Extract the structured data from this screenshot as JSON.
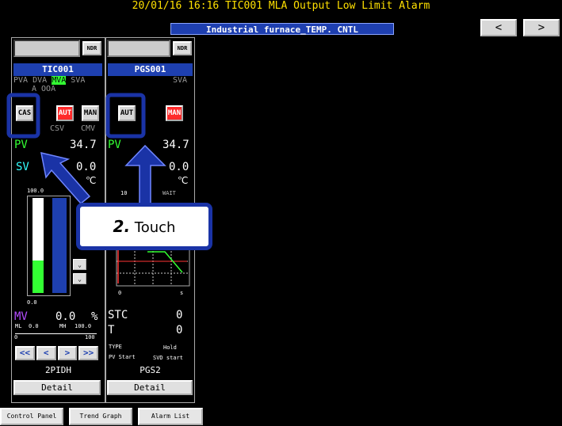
{
  "alarm_message": "20/01/16 16:16 TIC001 MLA Output Low Limit Alarm",
  "window_title": "Industrial furnace_TEMP. CNTL",
  "nav": {
    "prev": "<",
    "next": ">"
  },
  "faceplate1": {
    "ndr": "NDR",
    "tag": "TIC001",
    "modes_row1": [
      "PVA",
      "DVA",
      "MVA",
      "SVA"
    ],
    "modes_row2": "A OOA",
    "cas": "CAS",
    "aut": "AUT",
    "man": "MAN",
    "csv_label": "CSV",
    "cmv_label": "CMV",
    "pv_label": "PV",
    "pv_value": "34.7",
    "sv_label": "SV",
    "sv_value": "0.0",
    "unit": "℃",
    "scale_top": "100.0",
    "scale_bottom": "0.0",
    "mv_label": "MV",
    "mv_value": "0.0",
    "mv_unit": "%",
    "ml_label": "ML",
    "ml_value": "0.0",
    "mh_label": "MH",
    "mh_value": "100.0",
    "axis_min": "0",
    "axis_max": "100",
    "btns": [
      "<<",
      "<",
      ">",
      ">>"
    ],
    "control_type": "2PIDH",
    "detail": "Detail"
  },
  "faceplate2": {
    "ndr": "NDR",
    "tag": "PGS001",
    "sva": "SVA",
    "aut": "AUT",
    "man": "MAN",
    "pv_label": "PV",
    "pv_value": "34.7",
    "sv_value": "0.0",
    "unit": "℃",
    "scale_top": "10",
    "wait": "WAIT",
    "chart_origin": "0",
    "chart_unit": "s",
    "stc_label": "STC",
    "stc_value": "0",
    "t_label": "T",
    "t_value": "0",
    "type_label": "TYPE",
    "type_value": "Hold",
    "pv_start": "PV Start",
    "svd_start": "SVD start",
    "control_type": "PGS2",
    "detail": "Detail"
  },
  "callout": {
    "step": "2.",
    "text": "Touch"
  },
  "tabs": [
    "Control Panel",
    "Trend Graph",
    "Alarm List"
  ],
  "colors": {
    "accent_blue": "#1a33a6",
    "pv_green": "#33ff33",
    "sv_cyan": "#33ffff",
    "mv_purple": "#b44dff",
    "alarm_yellow": "#ffe000"
  }
}
